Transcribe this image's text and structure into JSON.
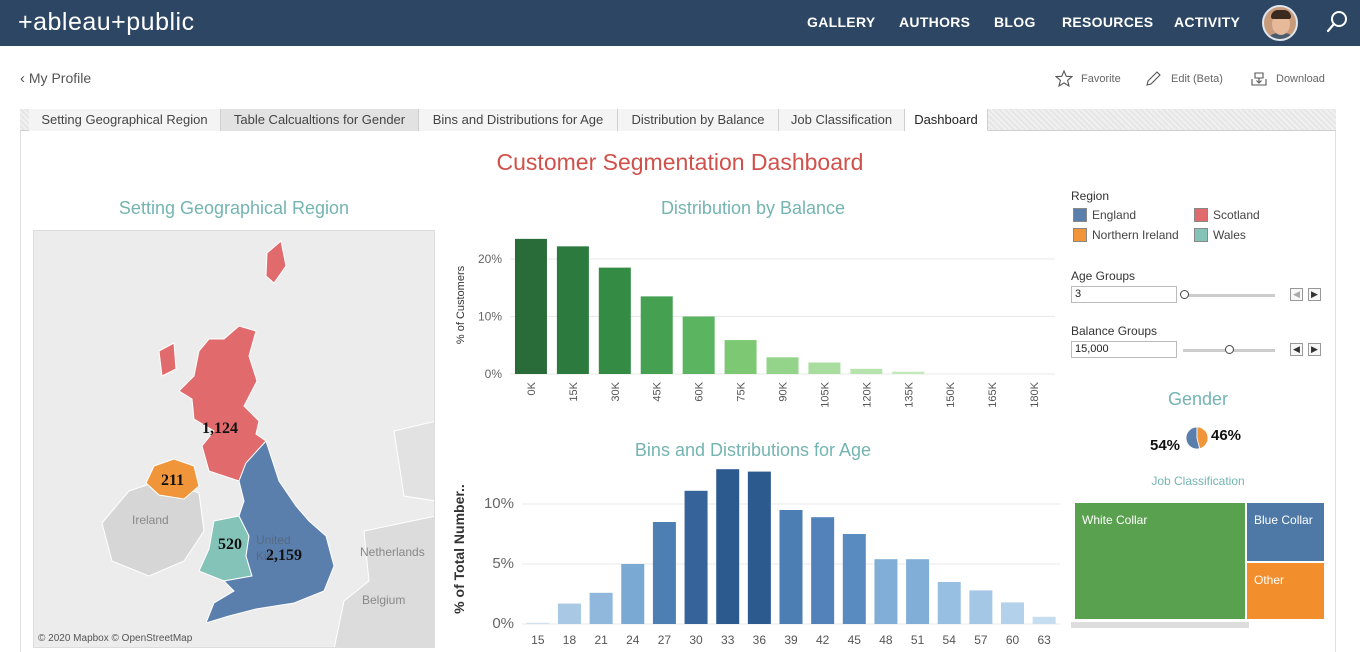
{
  "nav": {
    "logo": "+ableau+public",
    "links": [
      "GALLERY",
      "AUTHORS",
      "BLOG",
      "RESOURCES",
      "ACTIVITY"
    ]
  },
  "profile_bar": {
    "back_label": "My Profile",
    "favorite": "Favorite",
    "edit": "Edit (Beta)",
    "download": "Download"
  },
  "tabs": [
    "Setting Geographical Region",
    "Table Calcualtions for Gender",
    "Bins and Distributions for Age",
    "Distribution by Balance",
    "Job Classification",
    "Dashboard"
  ],
  "active_tab": "Dashboard",
  "dashboard": {
    "title": "Customer Segmentation Dashboard",
    "map": {
      "title": "Setting Geographical Region",
      "credit": "© 2020 Mapbox © OpenStreetMap",
      "labels": [
        "Ireland",
        "United",
        "Kin",
        "Netherlands",
        "Belgium"
      ],
      "values": {
        "scotland": "1,124",
        "northern_ireland": "211",
        "wales": "520",
        "england": "2,159"
      }
    },
    "legend": {
      "title": "Region",
      "items": [
        {
          "label": "England",
          "color": "#5b7fad"
        },
        {
          "label": "Scotland",
          "color": "#e06a6c"
        },
        {
          "label": "Northern Ireland",
          "color": "#f0953a"
        },
        {
          "label": "Wales",
          "color": "#84c3b8"
        }
      ]
    },
    "age_groups": {
      "label": "Age Groups",
      "value": "3",
      "level": 0
    },
    "balance_groups": {
      "label": "Balance Groups",
      "value": "15,000",
      "level": 0.5
    },
    "gender": {
      "title": "Gender",
      "left_pct": "54%",
      "right_pct": "46%",
      "colors": [
        "#5b7fad",
        "#f0953a"
      ]
    },
    "job_classification": {
      "title": "Job Classification",
      "cells": [
        {
          "label": "White Collar",
          "color": "#59a14f"
        },
        {
          "label": "Blue Collar",
          "color": "#4e79a7"
        },
        {
          "label": "Other",
          "color": "#f28e2b"
        }
      ]
    }
  },
  "chart_data": [
    {
      "type": "bar",
      "title": "Distribution by Balance",
      "ylabel": "% of Customers",
      "ytick_labels": [
        "0%",
        "10%",
        "20%"
      ],
      "ylim": [
        0,
        24
      ],
      "categories": [
        "0K",
        "15K",
        "30K",
        "45K",
        "60K",
        "75K",
        "90K",
        "105K",
        "120K",
        "135K",
        "150K",
        "165K",
        "180K"
      ],
      "values": [
        23.5,
        22.2,
        18.5,
        13.5,
        10.0,
        5.9,
        2.9,
        2.0,
        0.9,
        0.4,
        0,
        0,
        0
      ],
      "colors": [
        "#2a6b3a",
        "#2d7a3e",
        "#338b44",
        "#45a051",
        "#5bb560",
        "#7cc873",
        "#93d38a",
        "#a8dd9f",
        "#b7e4ae",
        "#c3e9bb",
        "#ccedc5",
        "#ccedc5",
        "#ccedc5"
      ]
    },
    {
      "type": "bar",
      "title": "Bins and Distributions for Age",
      "ylabel": "% of Total Number..",
      "ytick_labels": [
        "0%",
        "5%",
        "10%"
      ],
      "ylim": [
        0,
        12.5
      ],
      "categories": [
        "15",
        "18",
        "21",
        "24",
        "27",
        "30",
        "33",
        "36",
        "39",
        "42",
        "45",
        "48",
        "51",
        "54",
        "57",
        "60",
        "63"
      ],
      "values": [
        0.1,
        1.7,
        2.6,
        5.0,
        8.5,
        11.1,
        12.9,
        12.7,
        9.5,
        8.9,
        7.5,
        5.4,
        5.4,
        3.5,
        2.8,
        1.8,
        0.6
      ],
      "colors": [
        "#cfe0ef",
        "#a9c8e3",
        "#8fb8dc",
        "#7aaad4",
        "#4d7fb2",
        "#35639a",
        "#2c5a8f",
        "#2c5a8f",
        "#4c7eb4",
        "#5282b9",
        "#5a8bc0",
        "#80aed6",
        "#80aed6",
        "#97bfe1",
        "#a3c7e5",
        "#b3d1ea",
        "#c6ddef"
      ]
    },
    {
      "type": "pie",
      "title": "Gender",
      "labels": [
        "54%",
        "46%"
      ],
      "values": [
        54,
        46
      ],
      "colors": [
        "#5b7fad",
        "#f0953a"
      ]
    }
  ]
}
